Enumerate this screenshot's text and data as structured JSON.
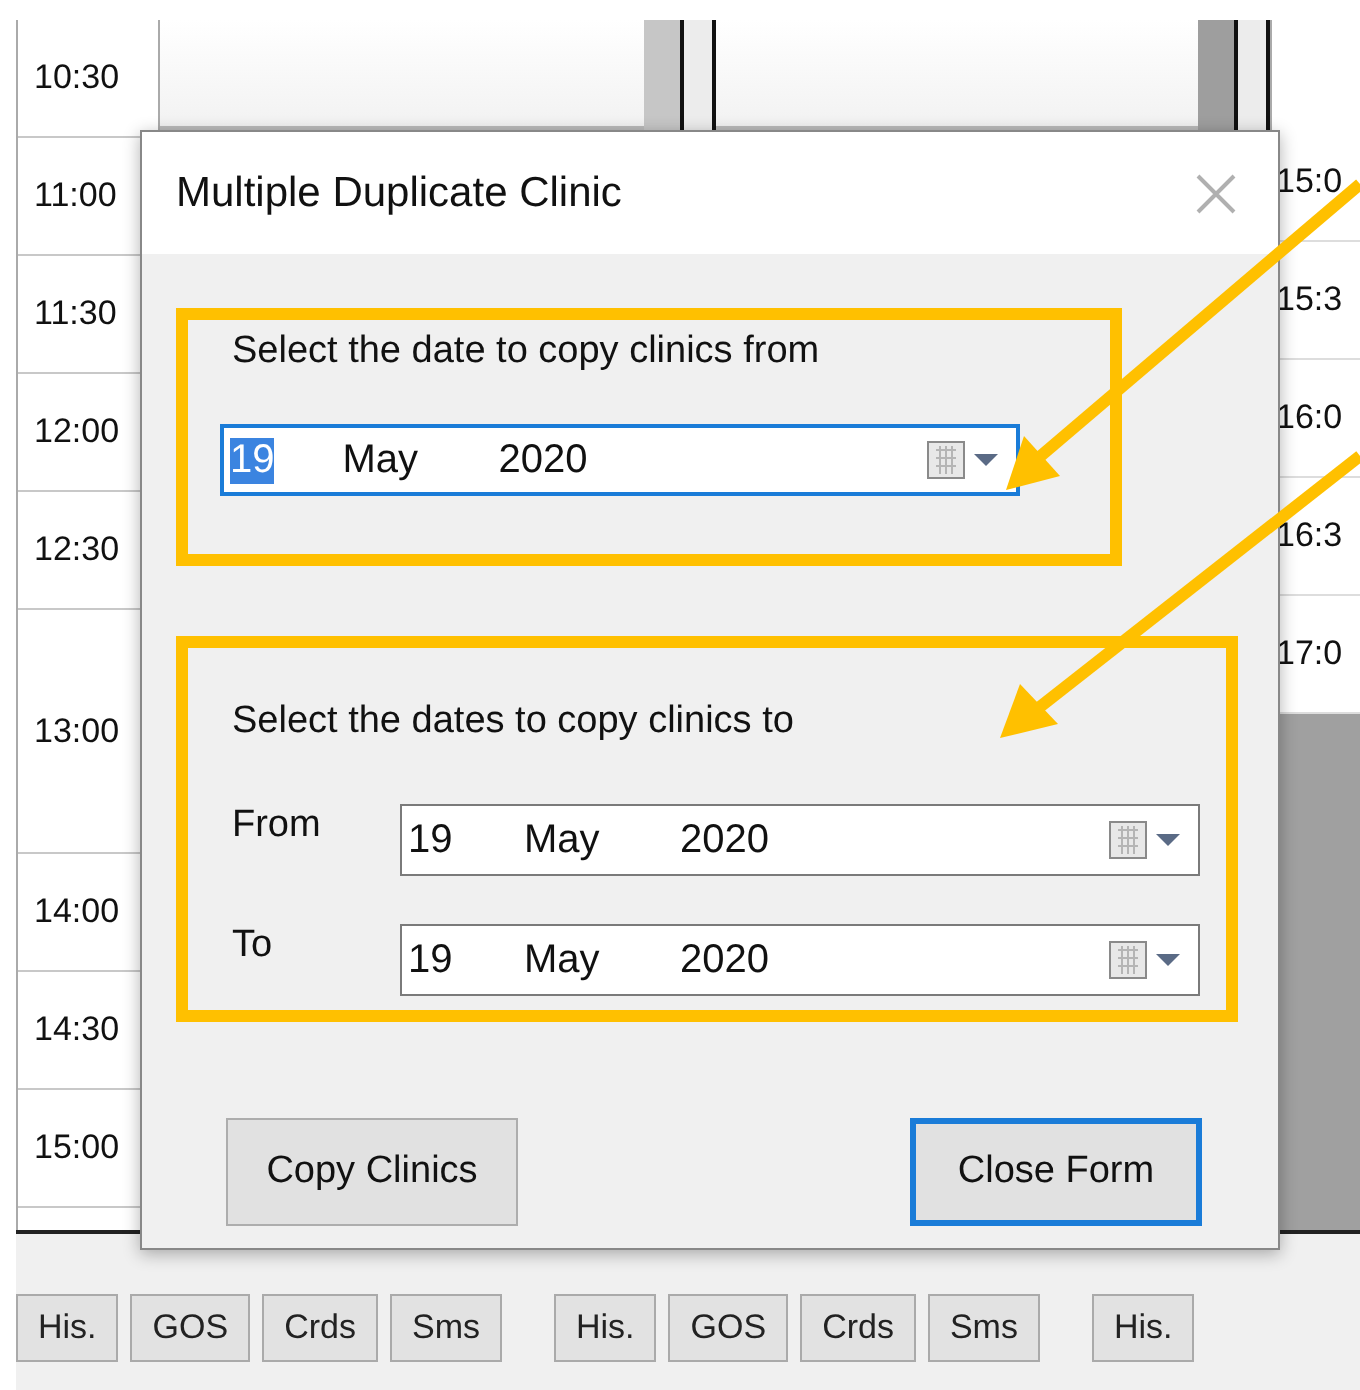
{
  "schedule": {
    "time_rows": [
      {
        "time": "10:30",
        "kind": "slot"
      },
      {
        "time": "11:00",
        "kind": "slot"
      },
      {
        "time": "11:30",
        "kind": "slot"
      },
      {
        "time": "12:00",
        "kind": "slot"
      },
      {
        "time": "12:30",
        "kind": "slot"
      },
      {
        "time": "13:00",
        "kind": "hour"
      },
      {
        "time": "14:00",
        "kind": "slot"
      },
      {
        "time": "14:30",
        "kind": "slot"
      },
      {
        "time": "15:00",
        "kind": "slot"
      }
    ],
    "right_times": [
      "15:0",
      "15:3",
      "16:0",
      "16:3",
      "17:0"
    ],
    "bottom_tabs": [
      "His.",
      "GOS",
      "Crds",
      "Sms",
      "His.",
      "GOS",
      "Crds",
      "Sms",
      "His."
    ]
  },
  "dialog": {
    "title": "Multiple Duplicate Clinic",
    "source": {
      "label": "Select the date to copy clinics from",
      "date": {
        "day": "19",
        "month": "May",
        "year": "2020",
        "focused": true,
        "day_selected": true
      }
    },
    "target": {
      "label": "Select the dates to copy clinics to",
      "rows": [
        {
          "label": "From",
          "date": {
            "day": "19",
            "month": "May",
            "year": "2020",
            "focused": false,
            "day_selected": false
          }
        },
        {
          "label": "To",
          "date": {
            "day": "19",
            "month": "May",
            "year": "2020",
            "focused": false,
            "day_selected": false
          }
        }
      ]
    },
    "buttons": [
      {
        "label": "Copy Clinics",
        "focused": false
      },
      {
        "label": "Close Form",
        "focused": true
      }
    ]
  }
}
